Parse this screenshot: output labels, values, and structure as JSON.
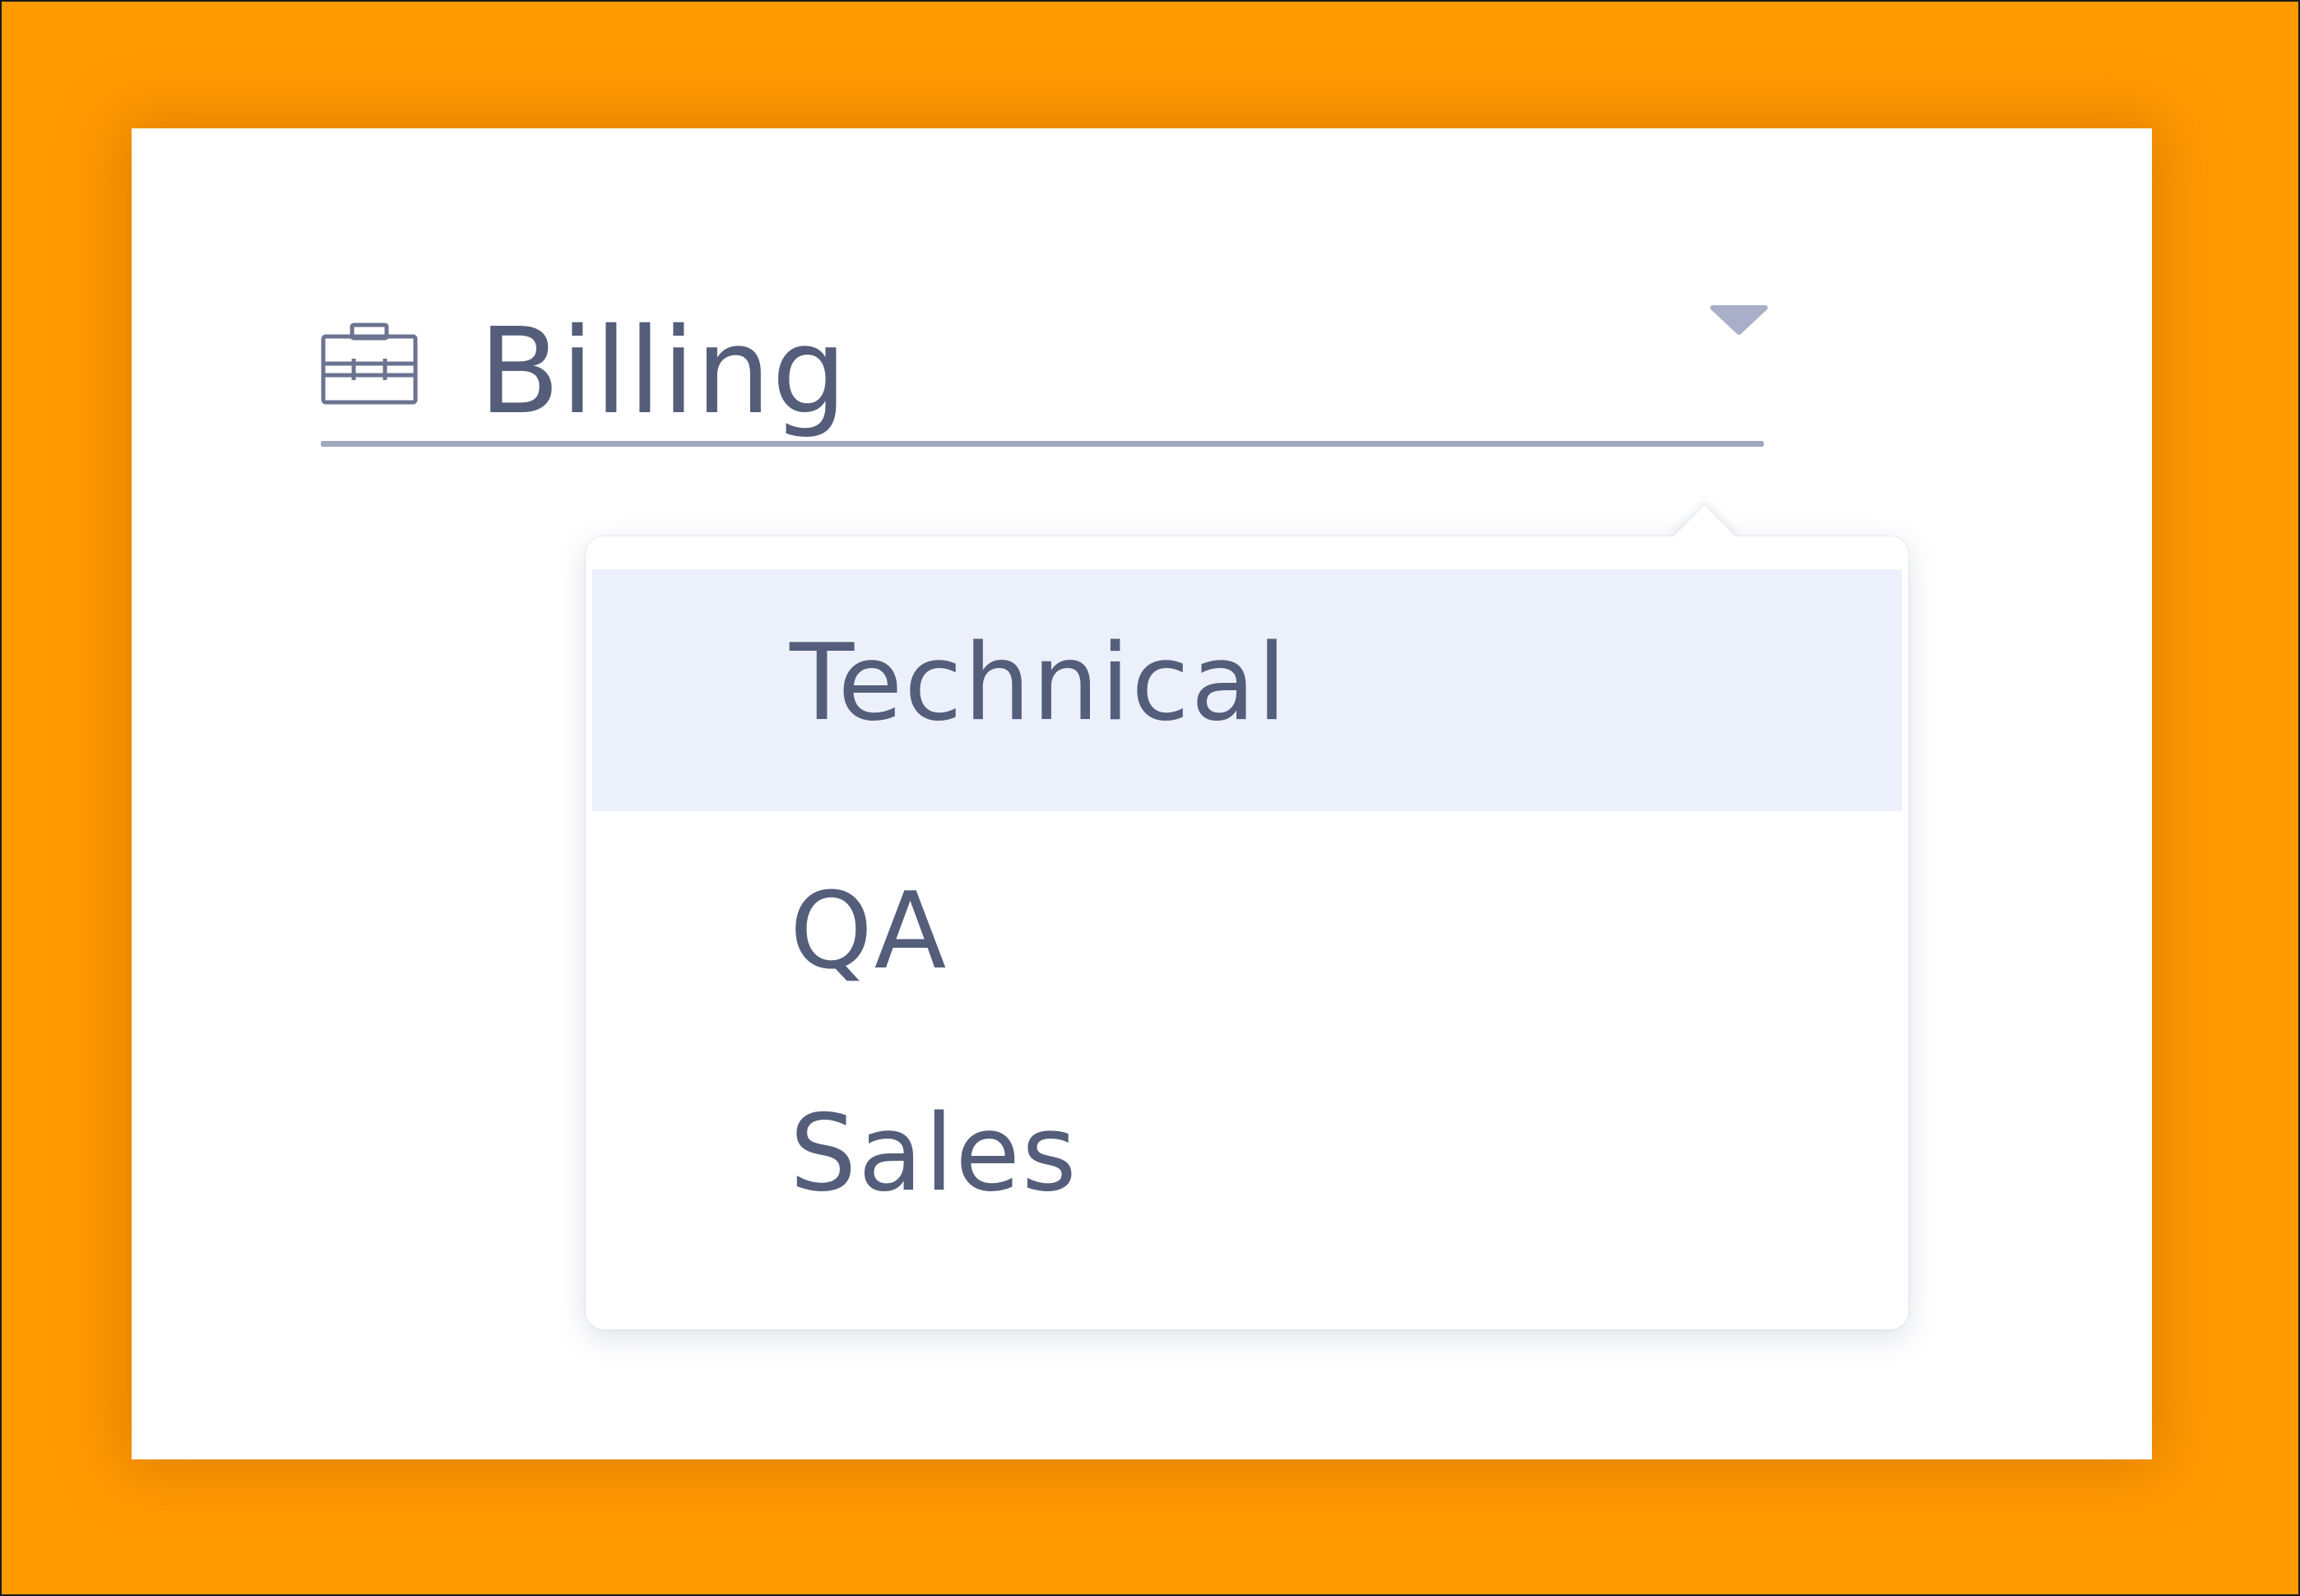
{
  "select": {
    "value": "Billing",
    "icon": "briefcase-icon",
    "caret_icon": "caret-down-icon"
  },
  "dropdown": {
    "options": [
      {
        "label": "Technical",
        "highlighted": true
      },
      {
        "label": "QA",
        "highlighted": false
      },
      {
        "label": "Sales",
        "highlighted": false
      }
    ]
  },
  "colors": {
    "background": "#ff9a00",
    "card": "#ffffff",
    "text": "#545e7a",
    "underline": "#a0a8c0",
    "highlight": "#ecf0fb",
    "caret": "#a9afc8"
  }
}
